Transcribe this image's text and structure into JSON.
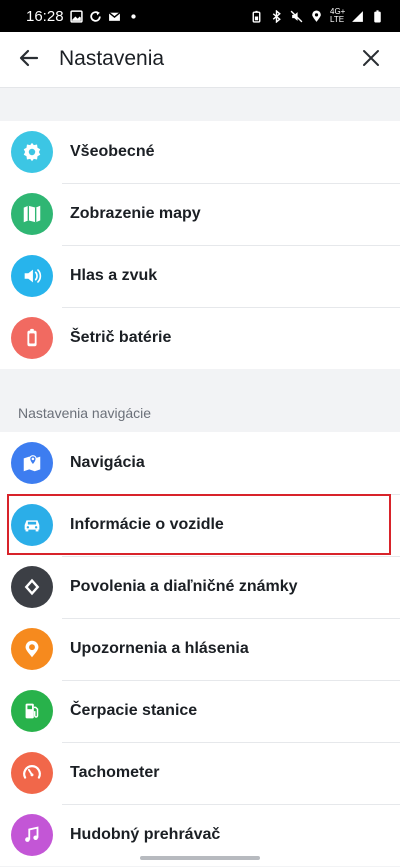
{
  "status_bar": {
    "time": "16:28",
    "network": "4G+",
    "network_sub": "LTE",
    "left_icons": [
      "image-icon",
      "sync-icon",
      "gmail-icon",
      "dot-icon"
    ],
    "right_icons": [
      "battery-saver-icon",
      "bluetooth-icon",
      "mute-icon",
      "location-icon",
      "signal-icon",
      "battery-icon"
    ]
  },
  "app_bar": {
    "title": "Nastavenia",
    "back_icon": "arrow-left-icon",
    "close_icon": "close-icon"
  },
  "group_general": {
    "items": [
      {
        "label": "Všeobecné",
        "icon": "gear-icon",
        "color": "#3cc6e4"
      },
      {
        "label": "Zobrazenie mapy",
        "icon": "map-icon",
        "color": "#2fb673"
      },
      {
        "label": "Hlas a zvuk",
        "icon": "speaker-icon",
        "color": "#27b4ec"
      },
      {
        "label": "Šetrič batérie",
        "icon": "battery-icon",
        "color": "#f16a61"
      }
    ]
  },
  "section_navigation": {
    "header": "Nastavenia navigácie",
    "items": [
      {
        "label": "Navigácia",
        "icon": "navigation-map-icon",
        "color": "#3d7df0"
      },
      {
        "label": "Informácie o vozidle",
        "icon": "car-icon",
        "color": "#2baee8",
        "highlighted": true
      },
      {
        "label": "Povolenia a diaľničné známky",
        "icon": "road-sign-icon",
        "color": "#3c3f45"
      },
      {
        "label": "Upozornenia a hlásenia",
        "icon": "alert-pin-icon",
        "color": "#f68a1e"
      },
      {
        "label": "Čerpacie stanice",
        "icon": "fuel-pump-icon",
        "color": "#28b24b"
      },
      {
        "label": "Tachometer",
        "icon": "speedometer-icon",
        "color": "#f1674a"
      },
      {
        "label": "Hudobný prehrávač",
        "icon": "music-note-icon",
        "color": "#c356d6"
      }
    ]
  },
  "highlight_color": "#d8232a"
}
